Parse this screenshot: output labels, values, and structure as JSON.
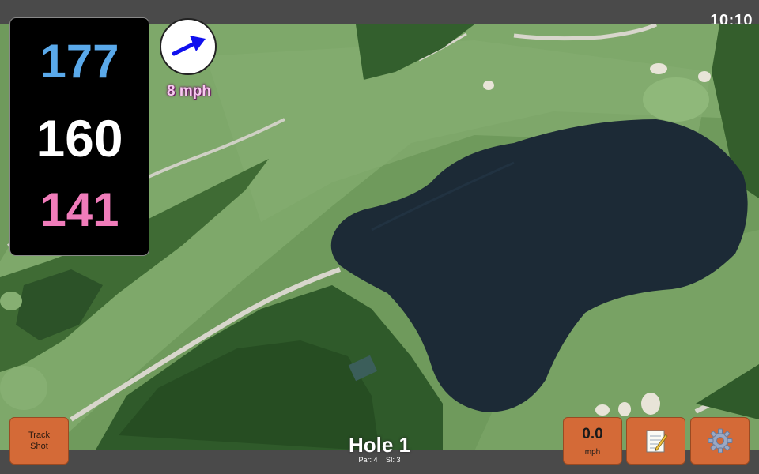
{
  "status": {
    "time": "10:10"
  },
  "distances": {
    "back": "177",
    "center": "160",
    "front": "141"
  },
  "wind": {
    "speed_label": "8 mph",
    "icon": "wind-direction-arrow-icon",
    "arrow_color": "#1010ee"
  },
  "buttons": {
    "track_shot": "Track\nShot",
    "speed_value": "0.0",
    "speed_unit": "mph",
    "notes_icon": "notepad-icon",
    "settings_icon": "gear-icon"
  },
  "hole": {
    "title": "Hole 1",
    "par_label": "Par: 4",
    "si_label": "SI: 3"
  },
  "colors": {
    "back_distance": "#5aa9ea",
    "center_distance": "#ffffff",
    "front_distance": "#f07cba",
    "button_bg": "#d46a37",
    "water": "#1c2a36",
    "fairway": "#7fa36a"
  }
}
